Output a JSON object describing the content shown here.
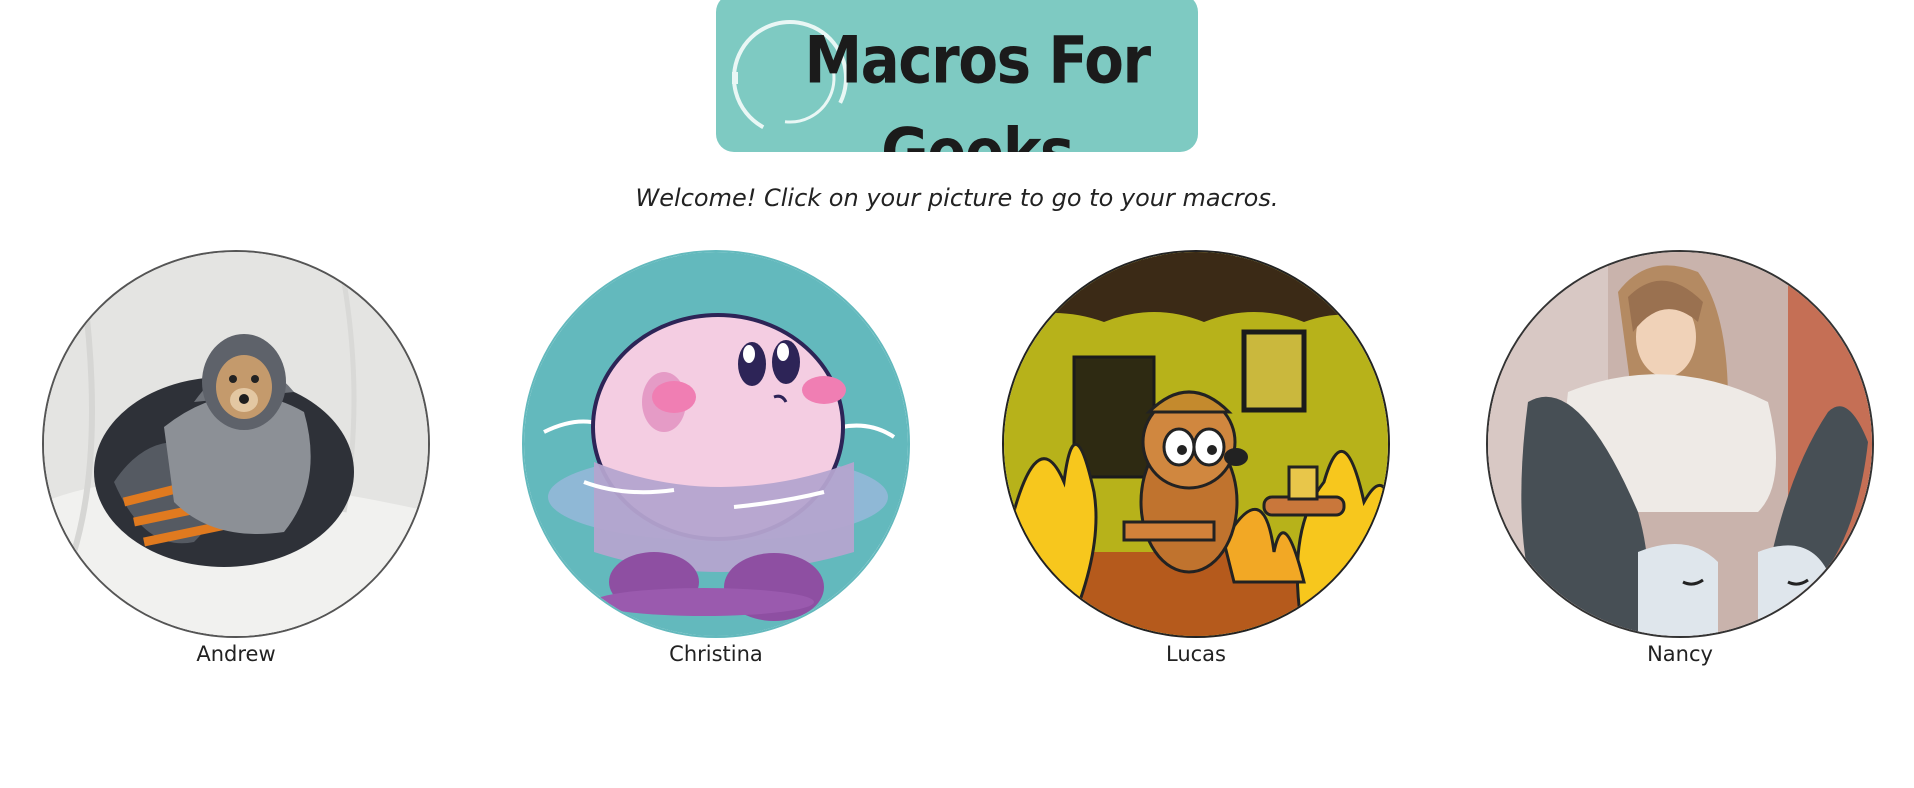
{
  "header": {
    "logo_text": "Macros For Geeks",
    "logo_bg": "#7ecac2"
  },
  "welcome_text": "Welcome! Click on your picture to go to your macros.",
  "profiles": [
    {
      "name": "Andrew",
      "picture": "dog-wrapped-in-blanket"
    },
    {
      "name": "Christina",
      "picture": "pink-character-in-water"
    },
    {
      "name": "Lucas",
      "picture": "dog-in-burning-room"
    },
    {
      "name": "Nancy",
      "picture": "person-sitting-portrait"
    }
  ]
}
